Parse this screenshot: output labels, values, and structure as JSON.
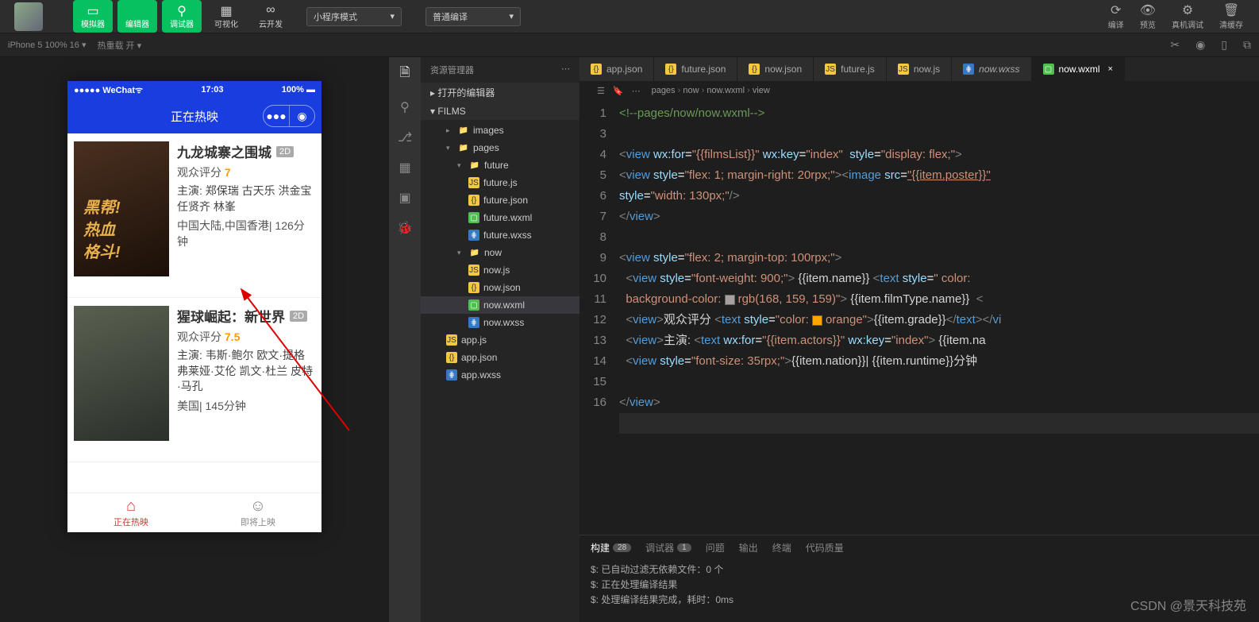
{
  "toolbar": {
    "buttons": [
      {
        "label": "模拟器",
        "green": true,
        "icon": "▭"
      },
      {
        "label": "编辑器",
        "green": true,
        "icon": "</>"
      },
      {
        "label": "调试器",
        "green": true,
        "icon": "⚲"
      },
      {
        "label": "可视化",
        "green": false,
        "icon": "▦"
      },
      {
        "label": "云开发",
        "green": false,
        "icon": "∞"
      }
    ],
    "mode_dropdown": "小程序模式",
    "compile_dropdown": "普通编译",
    "actions": [
      {
        "label": "编译",
        "icon": "⟳"
      },
      {
        "label": "预览",
        "icon": "👁"
      },
      {
        "label": "真机调试",
        "icon": "⚙"
      },
      {
        "label": "清缓存",
        "icon": "🗑"
      }
    ]
  },
  "secondbar": {
    "device": "iPhone 5 100% 16",
    "hot": "热重载 开"
  },
  "phone": {
    "carrier": "●●●●● WeChat",
    "signal": "📶",
    "time": "17:03",
    "battery": "100% ▬",
    "title": "正在热映",
    "films": [
      {
        "name": "九龙城寨之围城",
        "type": "2D",
        "gradeLabel": "观众评分",
        "grade": "7",
        "actors": "主演: 郑保瑞 古天乐 洪金宝 任贤齐 林峯",
        "meta": "中国大陆,中国香港| 126分钟"
      },
      {
        "name": "猩球崛起：新世界",
        "type": "2D",
        "gradeLabel": "观众评分",
        "grade": "7.5",
        "actors": "主演: 韦斯·鲍尔 欧文·提格 弗莱娅·艾伦 凯文·杜兰 皮特·马孔",
        "meta": "美国| 145分钟"
      }
    ],
    "tabs": [
      {
        "label": "正在热映",
        "icon": "⌂",
        "active": true
      },
      {
        "label": "即将上映",
        "icon": "☺",
        "active": false
      }
    ]
  },
  "explorer": {
    "title": "资源管理器",
    "section1": "打开的编辑器",
    "root": "FILMS",
    "tree": [
      {
        "label": "images",
        "type": "folder",
        "depth": 1,
        "open": false
      },
      {
        "label": "pages",
        "type": "folder",
        "depth": 1,
        "open": true
      },
      {
        "label": "future",
        "type": "folder",
        "depth": 2,
        "open": true
      },
      {
        "label": "future.js",
        "type": "js",
        "depth": 3
      },
      {
        "label": "future.json",
        "type": "json",
        "depth": 3
      },
      {
        "label": "future.wxml",
        "type": "wxml",
        "depth": 3
      },
      {
        "label": "future.wxss",
        "type": "wxss",
        "depth": 3
      },
      {
        "label": "now",
        "type": "folder",
        "depth": 2,
        "open": true
      },
      {
        "label": "now.js",
        "type": "js",
        "depth": 3
      },
      {
        "label": "now.json",
        "type": "json",
        "depth": 3
      },
      {
        "label": "now.wxml",
        "type": "wxml",
        "depth": 3,
        "active": true
      },
      {
        "label": "now.wxss",
        "type": "wxss",
        "depth": 3
      },
      {
        "label": "app.js",
        "type": "js",
        "depth": 1
      },
      {
        "label": "app.json",
        "type": "json",
        "depth": 1
      },
      {
        "label": "app.wxss",
        "type": "wxss",
        "depth": 1
      }
    ]
  },
  "editorTabs": [
    {
      "label": "app.json",
      "icon": "json"
    },
    {
      "label": "future.json",
      "icon": "json"
    },
    {
      "label": "now.json",
      "icon": "json"
    },
    {
      "label": "future.js",
      "icon": "js"
    },
    {
      "label": "now.js",
      "icon": "js"
    },
    {
      "label": "now.wxss",
      "icon": "wxss",
      "italic": true
    },
    {
      "label": "now.wxml",
      "icon": "wxml",
      "active": true
    }
  ],
  "breadcrumb": [
    "pages",
    "now",
    "now.wxml",
    "view"
  ],
  "code": {
    "lineStart": 1,
    "lines": [
      {
        "n": 1,
        "html": "<span class='tok-comment'>&lt;!--pages/now/now.wxml--&gt;</span>"
      },
      {
        "n": "",
        "html": ""
      },
      {
        "n": 3,
        "html": "<span class='tok-gray'>&lt;</span><span class='tok-tag'>view</span> <span class='tok-attr'>wx:for</span><span class='tok-white'>=</span><span class='tok-str'>\"{{filmsList}}\"</span> <span class='tok-attr'>wx:key</span><span class='tok-white'>=</span><span class='tok-str'>\"index\"</span>  <span class='tok-attr'>style</span><span class='tok-white'>=</span><span class='tok-str'>\"display: flex;\"</span><span class='tok-gray'>&gt;</span>"
      },
      {
        "n": 4,
        "html": "<span class='tok-gray'>&lt;</span><span class='tok-tag'>view</span> <span class='tok-attr'>style</span><span class='tok-white'>=</span><span class='tok-str'>\"flex: 1; margin-right: 20rpx;\"</span><span class='tok-gray'>&gt;&lt;</span><span class='tok-tag'>image</span> <span class='tok-attr'>src</span><span class='tok-white'>=</span><span class='tok-str' style='text-decoration:underline'>\"{{item.poster}}\"</span>"
      },
      {
        "n": "",
        "html": "<span class='tok-attr'>style</span><span class='tok-white'>=</span><span class='tok-str'>\"width: 130px;\"</span><span class='tok-gray'>/&gt;</span>"
      },
      {
        "n": 5,
        "html": "<span class='tok-gray'>&lt;/</span><span class='tok-tag'>view</span><span class='tok-gray'>&gt;</span>"
      },
      {
        "n": 6,
        "html": ""
      },
      {
        "n": 7,
        "html": "<span class='tok-gray'>&lt;</span><span class='tok-tag'>view</span> <span class='tok-attr'>style</span><span class='tok-white'>=</span><span class='tok-str'>\"flex: 2; margin-top: 100rpx;\"</span><span class='tok-gray'>&gt;</span>"
      },
      {
        "n": 8,
        "html": "  <span class='tok-gray'>&lt;</span><span class='tok-tag'>view</span> <span class='tok-attr'>style</span><span class='tok-white'>=</span><span class='tok-str'>\"font-weight: 900;\"</span><span class='tok-gray'>&gt;</span> {{item.name}} <span class='tok-gray'>&lt;</span><span class='tok-tag'>text</span> <span class='tok-attr'>style</span><span class='tok-white'>=</span><span class='tok-str'>\" color:</span>"
      },
      {
        "n": "",
        "html": "  <span class='tok-str'>background-color: </span><span class='colorbox' style='background:rgb(168,159,159)'></span><span class='tok-str'>rgb(168, 159, 159)\"</span><span class='tok-gray'>&gt;</span> {{item.filmType.name}}  <span class='tok-gray'>&lt;</span>"
      },
      {
        "n": 9,
        "html": "  <span class='tok-gray'>&lt;</span><span class='tok-tag'>view</span><span class='tok-gray'>&gt;</span>观众评分 <span class='tok-gray'>&lt;</span><span class='tok-tag'>text</span> <span class='tok-attr'>style</span><span class='tok-white'>=</span><span class='tok-str'>\"color: </span><span class='colorbox' style='background:orange'></span><span class='tok-str'>orange\"</span><span class='tok-gray'>&gt;</span>{{item.grade}}<span class='tok-gray'>&lt;/</span><span class='tok-tag'>text</span><span class='tok-gray'>&gt;&lt;/</span><span class='tok-tag'>vi</span>"
      },
      {
        "n": 10,
        "html": "  <span class='tok-gray'>&lt;</span><span class='tok-tag'>view</span><span class='tok-gray'>&gt;</span>主演: <span class='tok-gray'>&lt;</span><span class='tok-tag'>text</span> <span class='tok-attr'>wx:for</span><span class='tok-white'>=</span><span class='tok-str'>\"{{item.actors}}\"</span> <span class='tok-attr'>wx:key</span><span class='tok-white'>=</span><span class='tok-str'>\"index\"</span><span class='tok-gray'>&gt;</span> {{item.na"
      },
      {
        "n": 11,
        "html": "  <span class='tok-gray'>&lt;</span><span class='tok-tag'>view</span> <span class='tok-attr'>style</span><span class='tok-white'>=</span><span class='tok-str'>\"font-size: 35rpx;\"</span><span class='tok-gray'>&gt;</span>{{item.nation}}| {{item.runtime}}分钟"
      },
      {
        "n": 12,
        "html": ""
      },
      {
        "n": 13,
        "html": "<span class='tok-gray'>&lt;/</span><span class='tok-tag'>view</span><span class='tok-gray'>&gt;</span>"
      },
      {
        "n": 14,
        "html": "<span class='cursor-line'> </span>"
      },
      {
        "n": 15,
        "html": ""
      },
      {
        "n": 16,
        "html": ""
      }
    ]
  },
  "bottomPanel": {
    "tabs": [
      {
        "label": "构建",
        "badge": "28",
        "active": true
      },
      {
        "label": "调试器",
        "badge": "1"
      },
      {
        "label": "问题"
      },
      {
        "label": "输出"
      },
      {
        "label": "终端"
      },
      {
        "label": "代码质量"
      }
    ],
    "lines": [
      "$: 已自动过滤无依赖文件：0 个",
      "$: 正在处理编译结果",
      "$: 处理编译结果完成，耗时：0ms"
    ]
  },
  "watermark": "CSDN @景天科技苑"
}
